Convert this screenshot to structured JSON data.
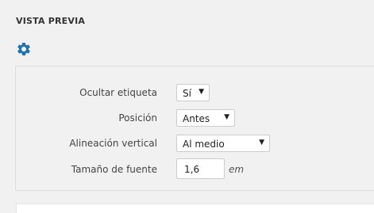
{
  "panel": {
    "title": "VISTA PREVIA",
    "settings_icon": "gear-icon",
    "accent_color": "#2271b1"
  },
  "form": {
    "hide_label": {
      "label": "Ocultar etiqueta",
      "value": "Sí"
    },
    "position": {
      "label": "Posición",
      "value": "Antes"
    },
    "vertical_align": {
      "label": "Alineación vertical",
      "value": "Al medio"
    },
    "font_size": {
      "label": "Tamaño de fuente",
      "value": "1,6",
      "unit": "em"
    }
  }
}
